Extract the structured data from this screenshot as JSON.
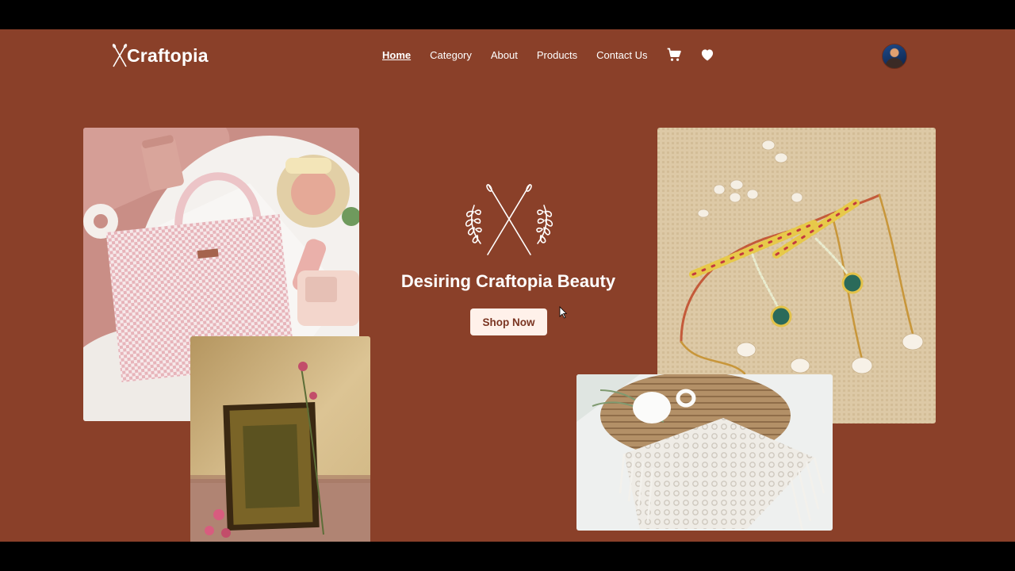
{
  "brand": {
    "name": "Craftopia"
  },
  "nav": {
    "links": [
      {
        "label": "Home",
        "active": true
      },
      {
        "label": "Category",
        "active": false
      },
      {
        "label": "About",
        "active": false
      },
      {
        "label": "Products",
        "active": false
      },
      {
        "label": "Contact Us",
        "active": false
      }
    ],
    "icons": [
      "cart-icon",
      "heart-icon"
    ]
  },
  "hero": {
    "title": "Desiring Craftopia Beauty",
    "cta_label": "Shop Now"
  },
  "colors": {
    "page_background": "#8a4029",
    "button_background": "#fff1ea",
    "button_text": "#7a3421",
    "text": "#ffffff"
  },
  "images": [
    {
      "name": "tote-bag-photo"
    },
    {
      "name": "photo-frame-photo"
    },
    {
      "name": "beaded-rakhi-photo"
    },
    {
      "name": "macrame-photo"
    }
  ]
}
